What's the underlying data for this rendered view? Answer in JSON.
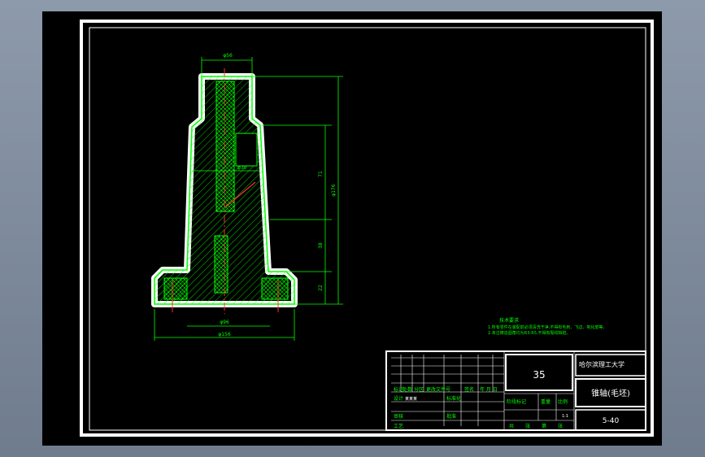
{
  "title_block": {
    "material": "35",
    "school": "哈尔滨理工大学",
    "part_name": "锥轴(毛坯)",
    "drawing_no": "5-40",
    "scale": "1:1",
    "grid_labels": [
      "标记",
      "处数",
      "分区",
      "更改文件号",
      "签名",
      "年 月 日"
    ],
    "left_rows": [
      "设计",
      "审核",
      "工艺"
    ],
    "right_labels": [
      "阶段标记",
      "重量",
      "比例"
    ],
    "bottom_labels": [
      "共",
      "张",
      "第",
      "张"
    ],
    "std_label": "标准化",
    "approve_label": "批准",
    "signer": "某某某"
  },
  "tech_req": {
    "title": "技术要求",
    "lines": [
      "1.所有零件在装配前必须清洗干净,不得有毛刺、飞边、氧化皮等。",
      "2.未注铸造圆角均为R3-R5,不得有裂纹缺陷。"
    ]
  },
  "dimensions": {
    "top_dia": "φ56",
    "bottom_dia": "φ156",
    "inner_dia": "φ96",
    "center_dia": "φ30",
    "h_upper": "71",
    "h_total": "φ176",
    "h_lower": "38",
    "h_base": "22"
  }
}
